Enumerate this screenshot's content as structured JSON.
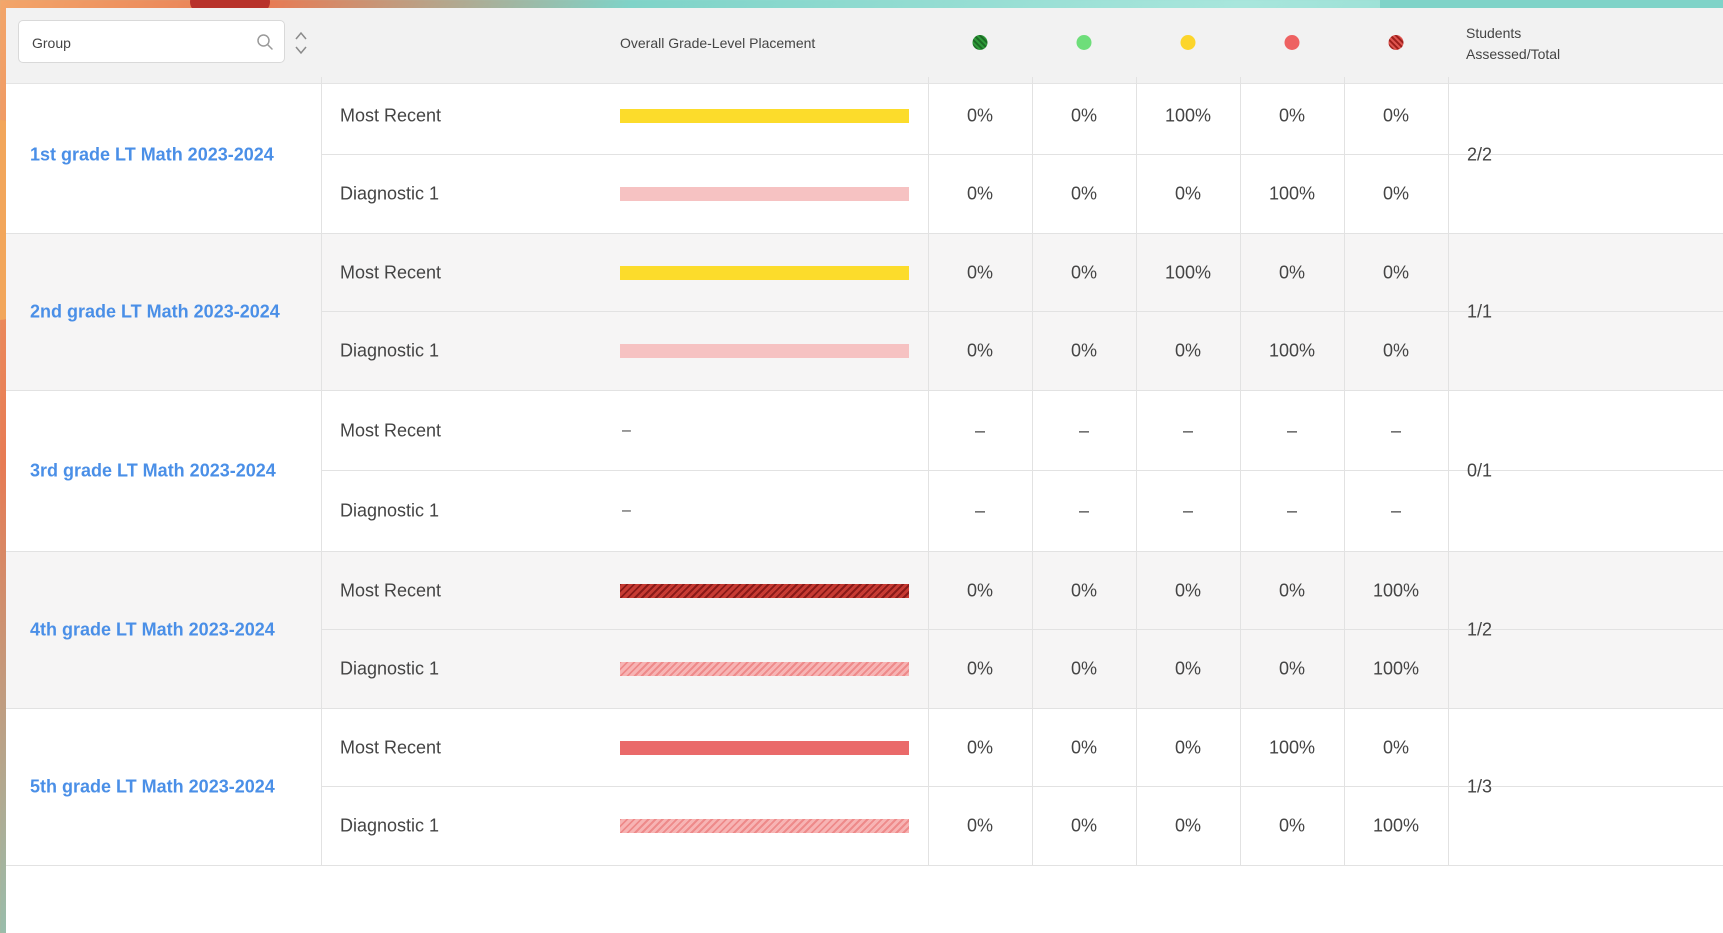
{
  "search": {
    "placeholder": "Group"
  },
  "header": {
    "placement_label": "Overall Grade-Level Placement",
    "students_label_line1": "Students",
    "students_label_line2": "Assessed/Total",
    "legend_colors": [
      "#2e9b3a",
      "#6ede7a",
      "#fcd52b",
      "#ee6262",
      "#c7352e"
    ]
  },
  "groups": [
    {
      "name": "1st grade LT Math 2023-2024",
      "students": "2/2",
      "rows": [
        {
          "label": "Most Recent",
          "bar_style": "yellow",
          "bar_text": "",
          "pcts": [
            "0%",
            "0%",
            "100%",
            "0%",
            "0%"
          ]
        },
        {
          "label": "Diagnostic 1",
          "bar_style": "pink",
          "bar_text": "",
          "pcts": [
            "0%",
            "0%",
            "0%",
            "100%",
            "0%"
          ]
        }
      ]
    },
    {
      "name": "2nd grade LT Math 2023-2024",
      "students": "1/1",
      "rows": [
        {
          "label": "Most Recent",
          "bar_style": "yellow",
          "bar_text": "",
          "pcts": [
            "0%",
            "0%",
            "100%",
            "0%",
            "0%"
          ]
        },
        {
          "label": "Diagnostic 1",
          "bar_style": "pink",
          "bar_text": "",
          "pcts": [
            "0%",
            "0%",
            "0%",
            "100%",
            "0%"
          ]
        }
      ]
    },
    {
      "name": "3rd grade LT Math 2023-2024",
      "students": "0/1",
      "rows": [
        {
          "label": "Most Recent",
          "bar_style": "none",
          "bar_text": "–",
          "pcts": [
            "–",
            "–",
            "–",
            "–",
            "–"
          ]
        },
        {
          "label": "Diagnostic 1",
          "bar_style": "none",
          "bar_text": "–",
          "pcts": [
            "–",
            "–",
            "–",
            "–",
            "–"
          ]
        }
      ]
    },
    {
      "name": "4th grade LT Math 2023-2024",
      "students": "1/2",
      "rows": [
        {
          "label": "Most Recent",
          "bar_style": "hatch-dark",
          "bar_text": "",
          "pcts": [
            "0%",
            "0%",
            "0%",
            "0%",
            "100%"
          ]
        },
        {
          "label": "Diagnostic 1",
          "bar_style": "hatch-light",
          "bar_text": "",
          "pcts": [
            "0%",
            "0%",
            "0%",
            "0%",
            "100%"
          ]
        }
      ]
    },
    {
      "name": "5th grade LT Math 2023-2024",
      "students": "1/3",
      "rows": [
        {
          "label": "Most Recent",
          "bar_style": "red",
          "bar_text": "",
          "pcts": [
            "0%",
            "0%",
            "0%",
            "100%",
            "0%"
          ]
        },
        {
          "label": "Diagnostic 1",
          "bar_style": "hatch-light",
          "bar_text": "",
          "pcts": [
            "0%",
            "0%",
            "0%",
            "0%",
            "100%"
          ]
        }
      ]
    }
  ]
}
